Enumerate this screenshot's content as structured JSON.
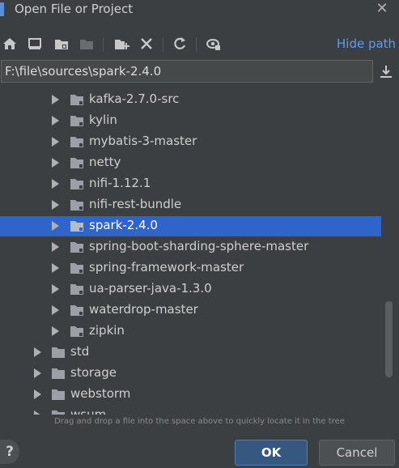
{
  "window": {
    "title": "Open File or Project"
  },
  "toolbar": {
    "icons": [
      "home-icon",
      "desktop-icon",
      "project-folder-icon",
      "module-folder-icon",
      "new-folder-icon",
      "delete-icon",
      "refresh-icon",
      "show-hidden-icon"
    ],
    "hide_path_label": "Hide path"
  },
  "path": {
    "value": "F:\\file\\sources\\spark-2.4.0"
  },
  "tree": {
    "items": [
      {
        "label": "kafka-2.7.0-src",
        "level": 2,
        "selected": false
      },
      {
        "label": "kylin",
        "level": 2,
        "selected": false
      },
      {
        "label": "mybatis-3-master",
        "level": 2,
        "selected": false
      },
      {
        "label": "netty",
        "level": 2,
        "selected": false
      },
      {
        "label": "nifi-1.12.1",
        "level": 2,
        "selected": false
      },
      {
        "label": "nifi-rest-bundle",
        "level": 2,
        "selected": false
      },
      {
        "label": "spark-2.4.0",
        "level": 2,
        "selected": true
      },
      {
        "label": "spring-boot-sharding-sphere-master",
        "level": 2,
        "selected": false
      },
      {
        "label": "spring-framework-master",
        "level": 2,
        "selected": false
      },
      {
        "label": "ua-parser-java-1.3.0",
        "level": 2,
        "selected": false
      },
      {
        "label": "waterdrop-master",
        "level": 2,
        "selected": false
      },
      {
        "label": "zipkin",
        "level": 2,
        "selected": false
      },
      {
        "label": "std",
        "level": 1,
        "selected": false
      },
      {
        "label": "storage",
        "level": 1,
        "selected": false
      },
      {
        "label": "webstorm",
        "level": 1,
        "selected": false
      },
      {
        "label": "wsum",
        "level": 1,
        "selected": false
      }
    ]
  },
  "hint": "Drag and drop a file into the space above to quickly locate it in the tree",
  "buttons": {
    "help": "?",
    "ok": "OK",
    "cancel": "Cancel"
  },
  "colors": {
    "background": "#3c3f41",
    "selection": "#2f65ca",
    "link": "#589df6",
    "ok_button": "#365880"
  }
}
